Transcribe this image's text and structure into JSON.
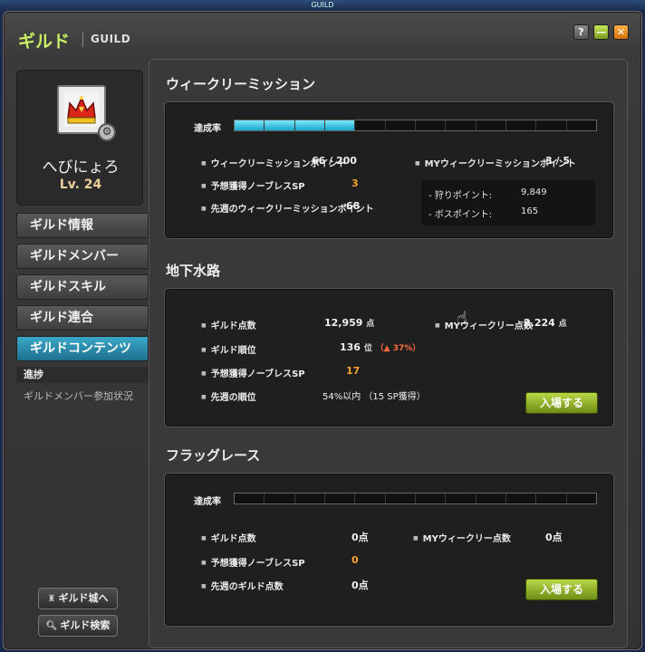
{
  "os_bar": {
    "title": "GUILD"
  },
  "window": {
    "title": "ギルド",
    "title_en": "GUILD",
    "help": "?",
    "minimize": "—",
    "close": "✕"
  },
  "profile": {
    "name": "へびにょろ",
    "level": "Lv. 24"
  },
  "menu": [
    {
      "label": "ギルド情報",
      "active": false
    },
    {
      "label": "ギルドメンバー",
      "active": false
    },
    {
      "label": "ギルドスキル",
      "active": false
    },
    {
      "label": "ギルド連合",
      "active": false
    },
    {
      "label": "ギルドコンテンツ",
      "active": true
    }
  ],
  "submenu": {
    "header": "進捗",
    "item": "ギルドメンバー参加状況"
  },
  "buttons": {
    "castle": "ギルド城へ",
    "search": "ギルド検索"
  },
  "weekly": {
    "title": "ウィークリーミッション",
    "rate_label": "達成率",
    "progress_fraction": 0.33,
    "point_label": "ウィークリーミッションポイント",
    "point_value": "66 / 200",
    "my_point_label": "MYウィークリーミッションポイント",
    "my_point_value": "3 / 5",
    "sp_label": "予想獲得ノーブレスSP",
    "sp_value": "3",
    "last_week_label": "先週のウィークリーミッションポイント",
    "last_week_value": "68",
    "hunt_label": "- 狩りポイント:",
    "hunt_value": "9,849",
    "boss_label": "- ボスポイント:",
    "boss_value": "165"
  },
  "underground": {
    "title": "地下水路",
    "score_label": "ギルド点数",
    "score_value": "12,959",
    "score_unit": "点",
    "my_weekly_label": "MYウィークリー点数",
    "my_weekly_value": "2,224",
    "my_weekly_unit": "点",
    "rank_label": "ギルド順位",
    "rank_value": "136",
    "rank_unit": "位",
    "rank_change": "（▲ 37%）",
    "sp_label": "予想獲得ノーブレスSP",
    "sp_value": "17",
    "last_rank_label": "先週の順位",
    "last_rank_value": "54%以内 （15 SP獲得）",
    "enter": "入場する"
  },
  "flag": {
    "title": "フラッグレース",
    "rate_label": "達成率",
    "progress_fraction": 0.0,
    "score_label": "ギルド点数",
    "score_value": "0点",
    "my_weekly_label": "MYウィークリー点数",
    "my_weekly_value": "0点",
    "sp_label": "予想獲得ノーブレスSP",
    "sp_value": "0",
    "last_score_label": "先週のギルド点数",
    "last_score_value": "0点",
    "enter": "入場する"
  },
  "colors": {
    "accent_title": "#c8f064",
    "progress": "#16a6c8",
    "enter_button": "#8aac20",
    "highlight_value": "#f3a32a"
  }
}
